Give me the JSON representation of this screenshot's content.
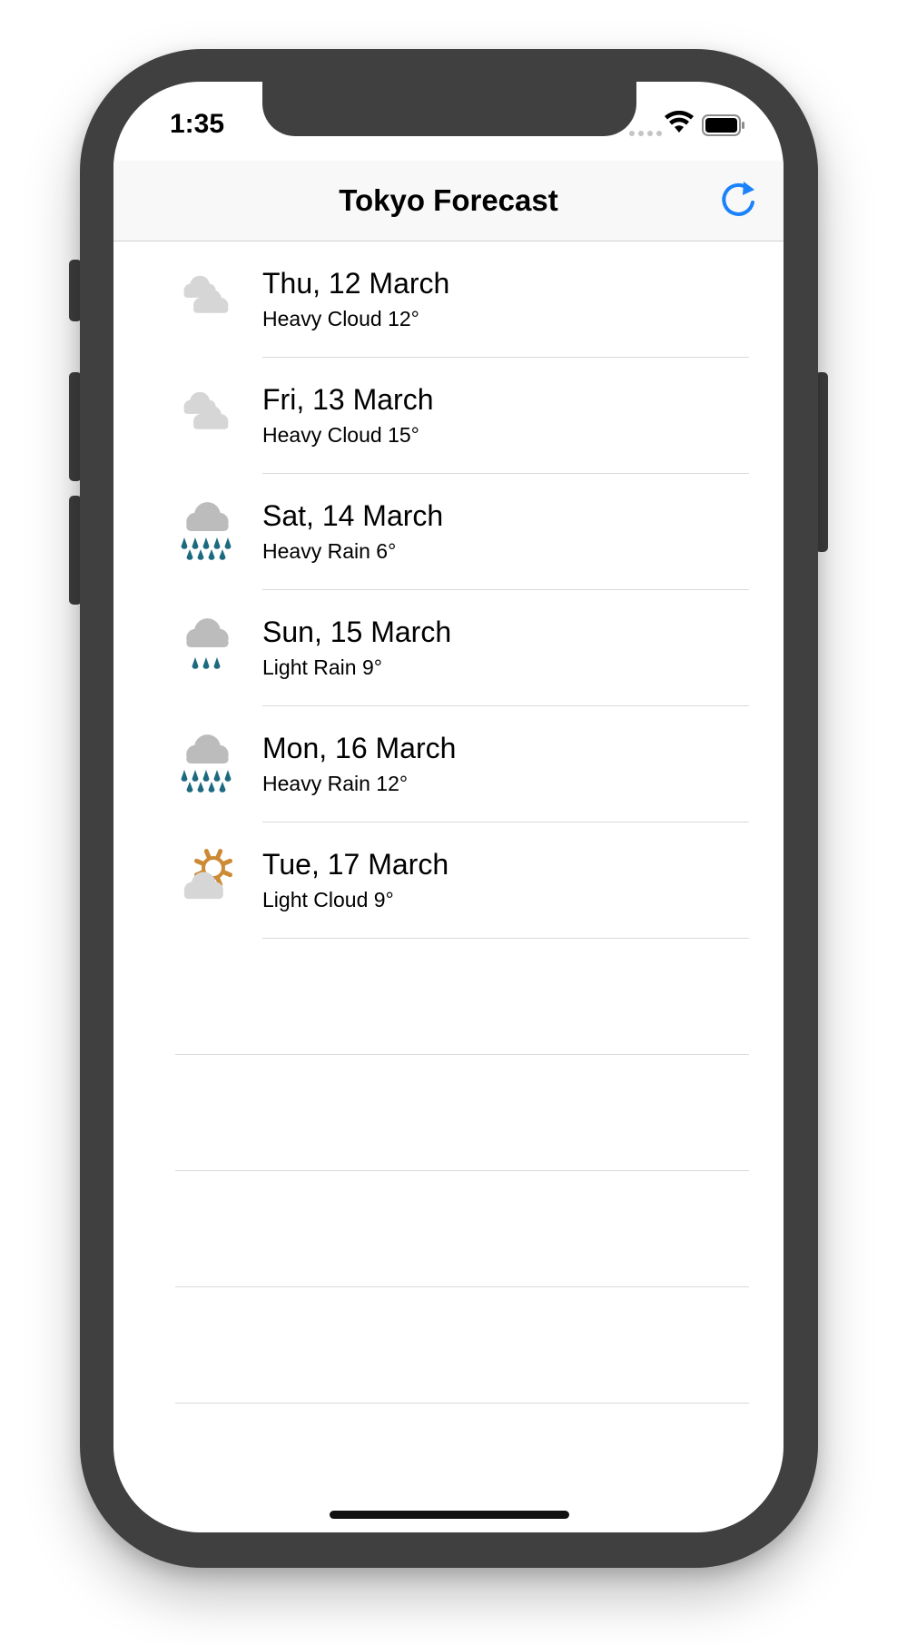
{
  "status_bar": {
    "time": "1:35"
  },
  "nav": {
    "title": "Tokyo Forecast",
    "refresh_icon": "refresh-icon"
  },
  "forecast": [
    {
      "date": "Thu, 12 March",
      "summary": "Heavy Cloud 12°",
      "icon": "heavy-cloud-icon"
    },
    {
      "date": "Fri, 13 March",
      "summary": "Heavy Cloud 15°",
      "icon": "heavy-cloud-icon"
    },
    {
      "date": "Sat, 14 March",
      "summary": "Heavy Rain 6°",
      "icon": "heavy-rain-icon"
    },
    {
      "date": "Sun, 15 March",
      "summary": "Light Rain 9°",
      "icon": "light-rain-icon"
    },
    {
      "date": "Mon, 16 March",
      "summary": "Heavy Rain 12°",
      "icon": "heavy-rain-icon"
    },
    {
      "date": "Tue, 17 March",
      "summary": "Light Cloud 9°",
      "icon": "light-cloud-icon"
    }
  ],
  "colors": {
    "accent": "#1a82fb",
    "cloud": "#d6d6d6",
    "rain_cloud": "#bcbcbc",
    "rain_drop": "#1d6a80",
    "sun": "#cc8a35",
    "frame": "#404040"
  }
}
